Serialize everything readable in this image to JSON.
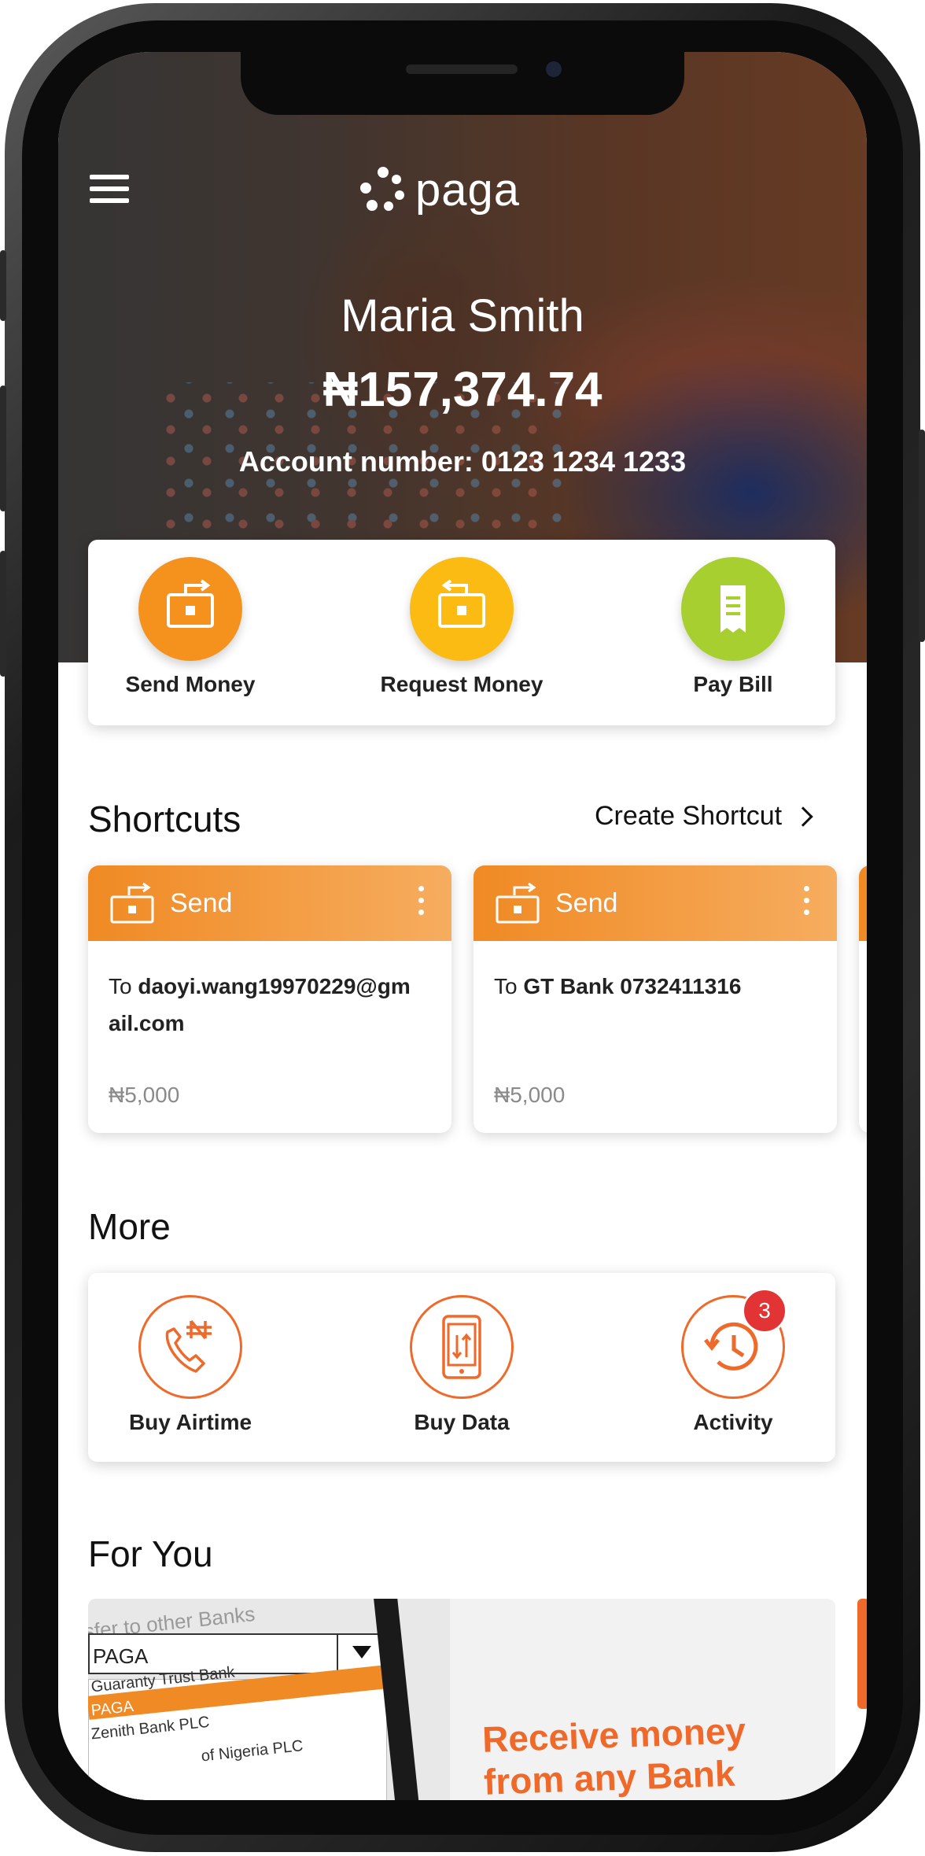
{
  "app": {
    "brand": "paga",
    "accent_color": "#f08a24",
    "menu_icon": "hamburger-menu-icon"
  },
  "account": {
    "name": "Maria Smith",
    "balance": "₦157,374.74",
    "account_number": "Account number: 0123 1234 1233"
  },
  "actions": [
    {
      "label": "Send Money",
      "icon": "send-money-icon",
      "color": "#f5921e"
    },
    {
      "label": "Request Money",
      "icon": "request-money-icon",
      "color": "#fbbb12"
    },
    {
      "label": "Pay Bill",
      "icon": "bill-receipt-icon",
      "color": "#a8cf30"
    }
  ],
  "shortcuts": {
    "title": "Shortcuts",
    "create_label": "Create Shortcut",
    "items": [
      {
        "type": "Send",
        "to_prefix": "To",
        "recipient": "daoyi.wang19970229@gm ail.com",
        "amount": "₦5,000"
      },
      {
        "type": "Send",
        "to_prefix": "To",
        "recipient": "GT Bank 0732411316",
        "amount": "₦5,000"
      }
    ]
  },
  "more": {
    "title": "More",
    "items": [
      {
        "label": "Buy Airtime",
        "icon": "phone-airtime-icon"
      },
      {
        "label": "Buy Data",
        "icon": "mobile-data-icon"
      },
      {
        "label": "Activity",
        "icon": "history-clock-icon",
        "badge": "3"
      }
    ]
  },
  "for_you": {
    "title": "For You",
    "promo": {
      "top_text": "nsfer to other Banks",
      "select_value": "PAGA",
      "list": [
        "Guaranty Trust Bank",
        "PAGA",
        "Zenith Bank PLC",
        "of Nigeria PLC"
      ],
      "headline_line1": "Receive money",
      "headline_line2": "from any Bank"
    }
  }
}
